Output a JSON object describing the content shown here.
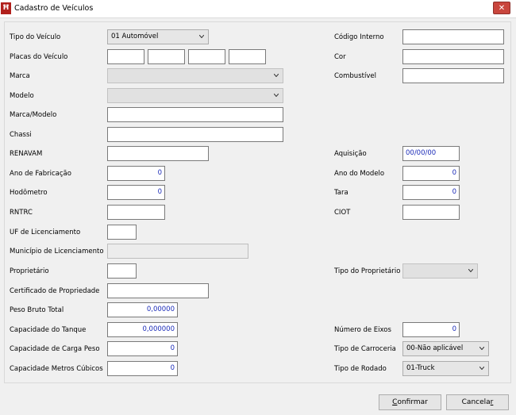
{
  "window": {
    "title": "Cadastro de Veículos",
    "close_label": "✕"
  },
  "labels": {
    "tipo_veiculo": "Tipo do Veículo",
    "placas": "Placas do Veículo",
    "marca": "Marca",
    "modelo": "Modelo",
    "marca_modelo": "Marca/Modelo",
    "chassi": "Chassi",
    "renavam": "RENAVAM",
    "ano_fabricacao": "Ano de Fabricação",
    "hodometro": "Hodômetro",
    "rntrc": "RNTRC",
    "uf_licenciamento": "UF de Licenciamento",
    "municipio_licenciamento": "Município de Licenciamento",
    "proprietario": "Proprietário",
    "certificado": "Certificado de Propriedade",
    "peso_bruto": "Peso Bruto Total",
    "cap_tanque": "Capacidade do Tanque",
    "cap_carga": "Capacidade de Carga Peso",
    "cap_m3": "Capacidade Metros Cúbicos",
    "codigo_interno": "Código Interno",
    "cor": "Cor",
    "combustivel": "Combustível",
    "aquisicao": "Aquisição",
    "ano_modelo": "Ano do Modelo",
    "tara": "Tara",
    "ciot": "CIOT",
    "tipo_proprietario": "Tipo do Proprietário",
    "numero_eixos": "Número de Eixos",
    "tipo_carroceria": "Tipo de Carroceria",
    "tipo_rodado": "Tipo de Rodado"
  },
  "values": {
    "tipo_veiculo": "01 Automóvel",
    "aquisicao": "00/00/00",
    "ano_fabricacao": "0",
    "ano_modelo": "0",
    "hodometro": "0",
    "tara": "0",
    "peso_bruto": "0,00000",
    "cap_tanque": "0,000000",
    "cap_carga": "0",
    "cap_m3": "0",
    "numero_eixos": "0",
    "tipo_carroceria": "00-Não aplicável",
    "tipo_rodado": "01-Truck"
  },
  "buttons": {
    "confirmar_prefix": "",
    "confirmar_key": "C",
    "confirmar_rest": "onfirmar",
    "cancelar_prefix": "Cancela",
    "cancelar_key": "r",
    "cancelar_rest": ""
  }
}
